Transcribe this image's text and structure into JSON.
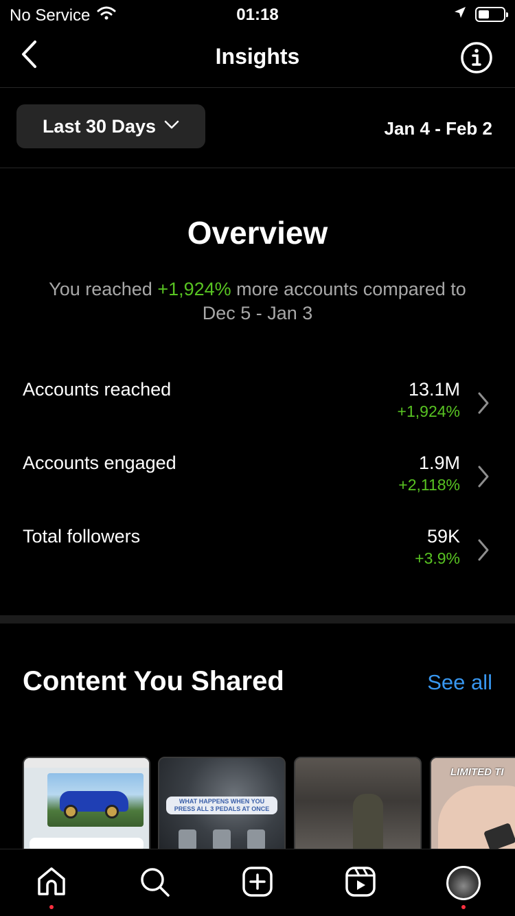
{
  "status_bar": {
    "carrier": "No Service",
    "time": "01:18",
    "battery_level": 0.45
  },
  "nav": {
    "title": "Insights",
    "back_icon": "chevron-left-icon",
    "info_icon": "info-icon"
  },
  "filter": {
    "range_label": "Last 30 Days",
    "date_range": "Jan 4 - Feb 2"
  },
  "overview": {
    "title": "Overview",
    "summary_prefix": "You reached ",
    "summary_highlight": "+1,924%",
    "summary_suffix": " more accounts compared to Dec 5 - Jan 3"
  },
  "metrics": [
    {
      "label": "Accounts reached",
      "value": "13.1M",
      "change": "+1,924%"
    },
    {
      "label": "Accounts engaged",
      "value": "1.9M",
      "change": "+2,118%"
    },
    {
      "label": "Total followers",
      "value": "59K",
      "change": "+3.9%"
    }
  ],
  "content": {
    "title": "Content You Shared",
    "see_all": "See all",
    "thumbnails": [
      {
        "kind": "screenshot-blue-car"
      },
      {
        "kind": "car-interior",
        "caption": "WHAT HAPPENS WHEN YOU PRESS ALL 3 PEDALS AT ONCE"
      },
      {
        "kind": "street-night"
      },
      {
        "kind": "hand-keychain",
        "caption": "LIMITED TI"
      }
    ]
  },
  "tab_bar": {
    "tabs": [
      {
        "icon": "home-icon",
        "has_dot": true
      },
      {
        "icon": "search-icon",
        "has_dot": false
      },
      {
        "icon": "create-post-icon",
        "has_dot": false
      },
      {
        "icon": "reels-icon",
        "has_dot": false
      },
      {
        "icon": "profile-avatar",
        "has_dot": true
      }
    ]
  },
  "colors": {
    "background": "#000000",
    "accent_green": "#58c322",
    "link_blue": "#3897f0",
    "notification_dot": "#ff3040"
  }
}
